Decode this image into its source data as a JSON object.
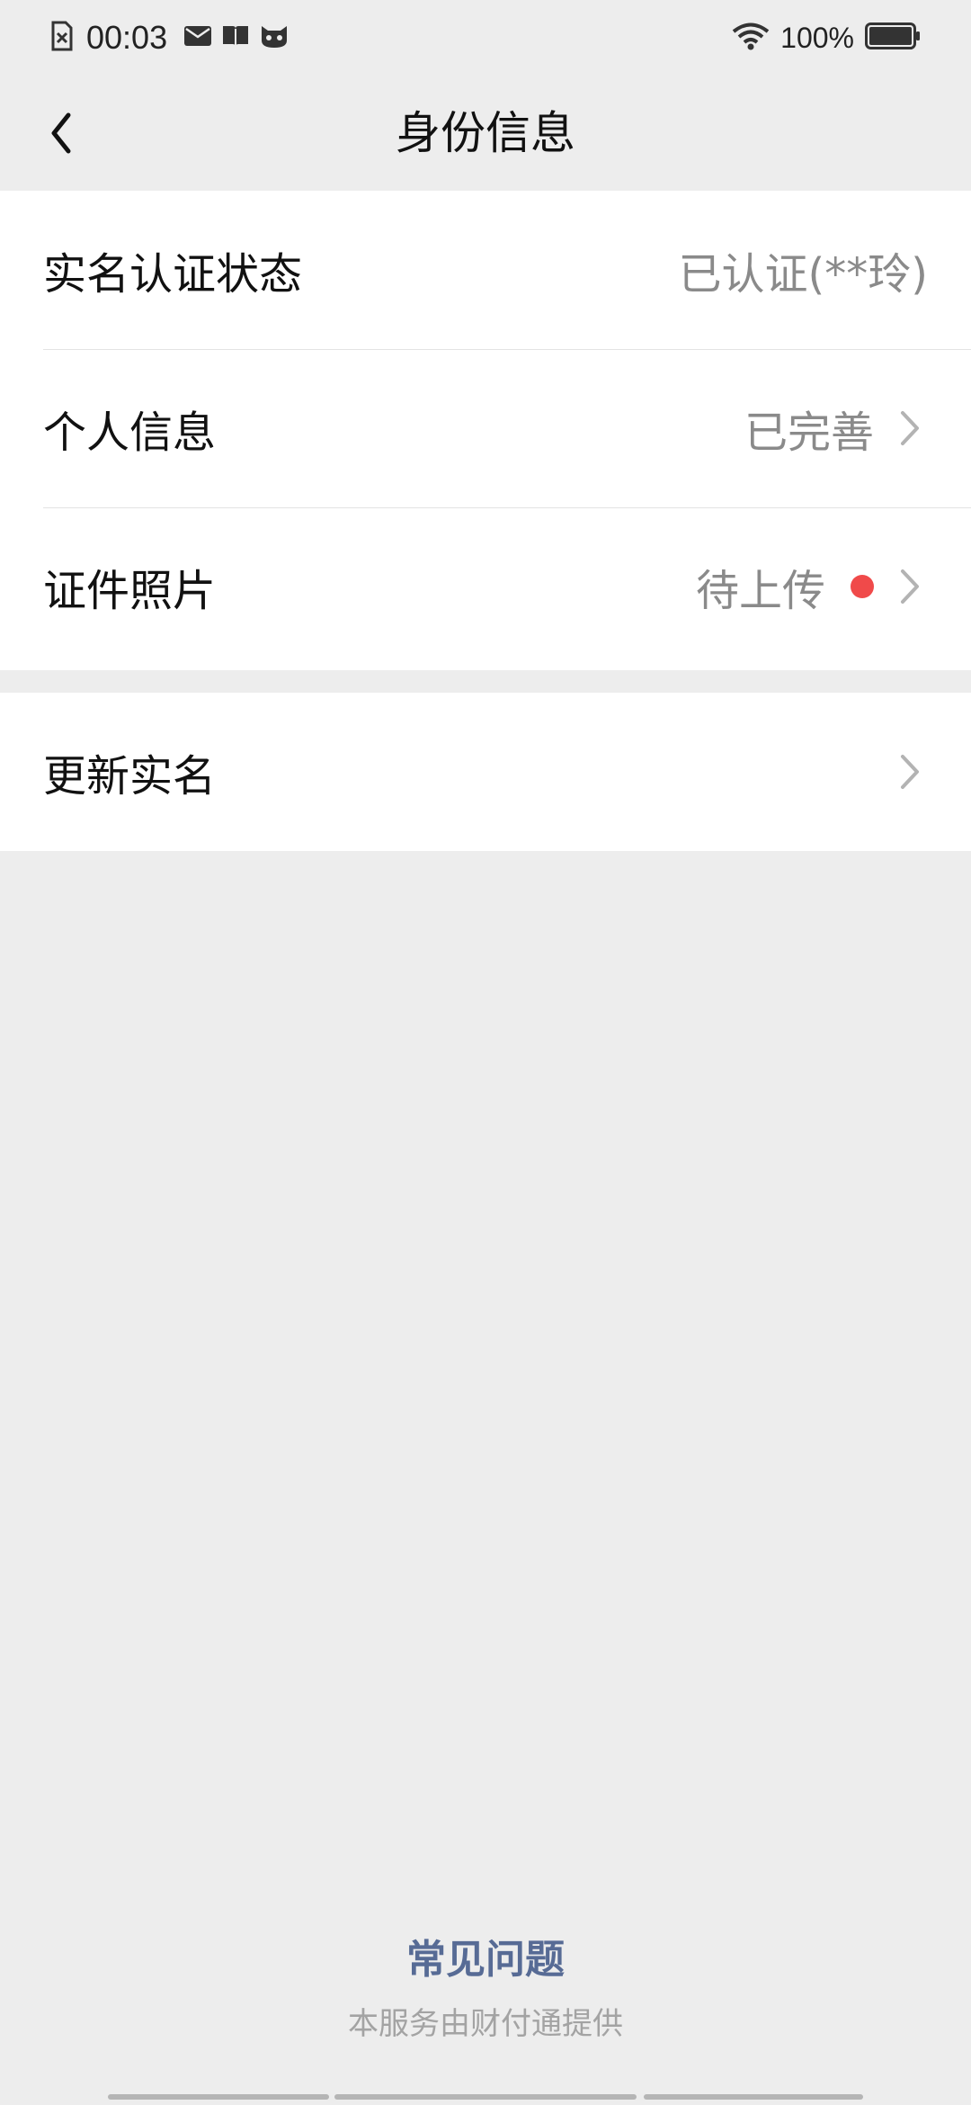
{
  "status_bar": {
    "time": "00:03",
    "battery": "100%",
    "icons": [
      "sim-error-icon",
      "mail-icon",
      "book-icon",
      "cat-face-icon",
      "wifi-icon",
      "battery-icon"
    ]
  },
  "nav": {
    "title": "身份信息",
    "back_icon": "chevron-left-icon"
  },
  "rows": [
    {
      "label": "实名认证状态",
      "value": "已认证(**玲)",
      "chevron": false,
      "dot": false
    },
    {
      "label": "个人信息",
      "value": "已完善",
      "chevron": true,
      "dot": false
    },
    {
      "label": "证件照片",
      "value": "待上传",
      "chevron": true,
      "dot": true
    },
    {
      "label": "更新实名",
      "value": "",
      "chevron": true,
      "dot": false
    }
  ],
  "footer": {
    "link": "常见问题",
    "note": "本服务由财付通提供"
  },
  "colors": {
    "background": "#ededed",
    "card": "#ffffff",
    "link": "#576b95",
    "dot": "#f04a4a",
    "value": "#8a8a8a"
  }
}
